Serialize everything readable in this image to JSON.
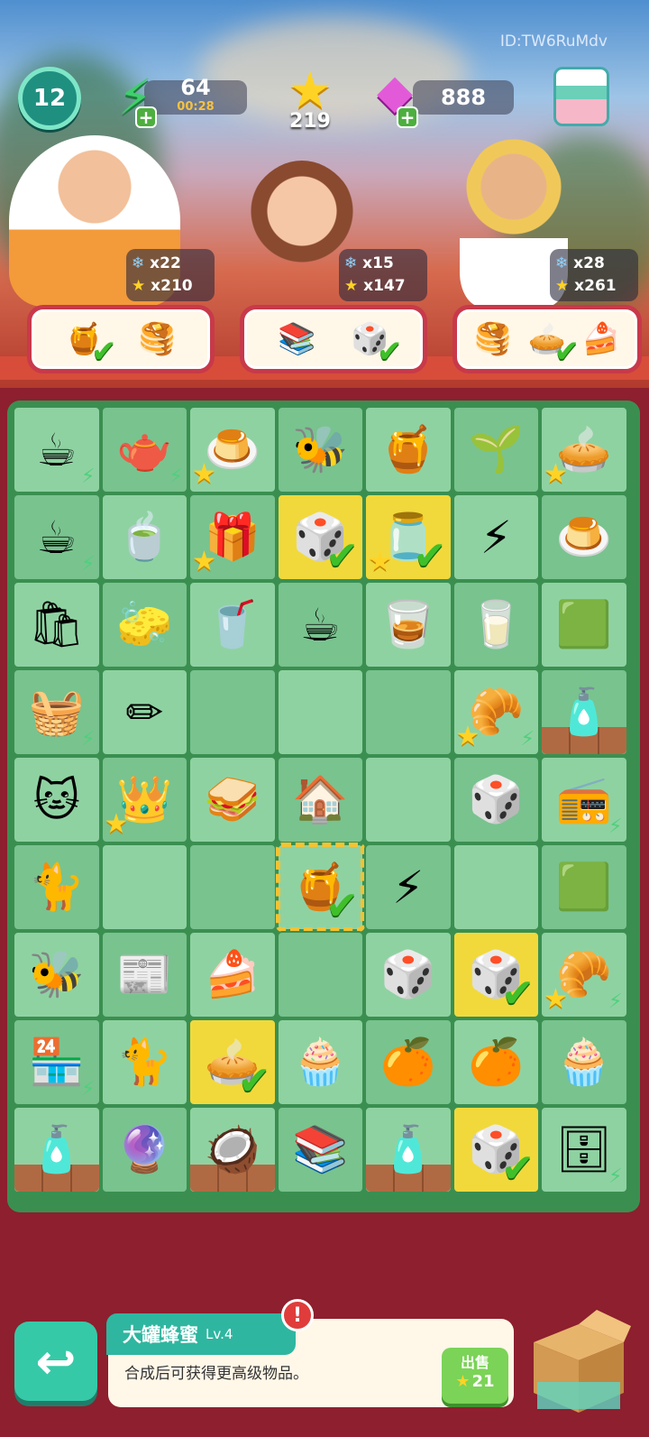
{
  "header": {
    "player_id": "ID:TW6RuMdv",
    "level": "12",
    "energy": {
      "value": "64",
      "timer": "00:28",
      "icon": "energy-bolt-icon"
    },
    "stars": {
      "value": "219",
      "icon": "star-icon"
    },
    "gems": {
      "value": "888",
      "icon": "gem-icon"
    },
    "shop_icon": "shop-stall-icon"
  },
  "customers": [
    {
      "snowflakes": "x22",
      "stars": "x210",
      "orders": [
        {
          "icon": "honey-jar",
          "glyph": "🍯",
          "done": true
        },
        {
          "icon": "pancakes",
          "glyph": "🥞",
          "done": false
        }
      ]
    },
    {
      "snowflakes": "x15",
      "stars": "x147",
      "orders": [
        {
          "icon": "books",
          "glyph": "📚",
          "done": false
        },
        {
          "icon": "dice-pawn",
          "glyph": "🎲",
          "done": true
        }
      ]
    },
    {
      "snowflakes": "x28",
      "stars": "x261",
      "orders": [
        {
          "icon": "pancakes",
          "glyph": "🥞",
          "done": false
        },
        {
          "icon": "orange-tart",
          "glyph": "🥧",
          "done": true
        },
        {
          "icon": "cake-slice",
          "glyph": "🍰",
          "done": false
        }
      ]
    }
  ],
  "board": [
    [
      {
        "i": "☕",
        "n": "teapot-tray",
        "bolt": true
      },
      {
        "i": "🫖",
        "n": "tea-set-tray",
        "bolt": true
      },
      {
        "i": "🍮",
        "n": "honey-pudding",
        "star": true
      },
      {
        "i": "🐝",
        "n": "beehive-small"
      },
      {
        "i": "🍯",
        "n": "beehive"
      },
      {
        "i": "🌱",
        "n": "sprout"
      },
      {
        "i": "🥧",
        "n": "fruit-tart",
        "star": true
      }
    ],
    [
      {
        "i": "☕",
        "n": "teapot-tray",
        "bolt": true
      },
      {
        "i": "🍵",
        "n": "tea-cup"
      },
      {
        "i": "🎁",
        "n": "mystery-chest",
        "star": true
      },
      {
        "i": "🎲",
        "n": "dice-pawn",
        "y": true,
        "chk": true
      },
      {
        "i": "🫙",
        "n": "glass-jar",
        "y": true,
        "chk": true,
        "star": true
      },
      {
        "i": "⚡",
        "n": "energy-bolt"
      },
      {
        "i": "🍮",
        "n": "flan"
      }
    ],
    [
      {
        "i": "🛍",
        "n": "shopping-bag"
      },
      {
        "i": "🧽",
        "n": "eraser"
      },
      {
        "i": "🥤",
        "n": "coffee-cup"
      },
      {
        "i": "☕",
        "n": "coffee-mug"
      },
      {
        "i": "🥃",
        "n": "cup-brown"
      },
      {
        "i": "🥛",
        "n": "water-glass"
      },
      {
        "i": "🟩",
        "n": "green-box"
      }
    ],
    [
      {
        "i": "🧺",
        "n": "picnic-basket",
        "bolt": true
      },
      {
        "i": "✏",
        "n": "pencil-sharpener"
      },
      {
        "i": "",
        "n": "empty"
      },
      {
        "i": "",
        "n": "empty"
      },
      {
        "i": "",
        "n": "empty"
      },
      {
        "i": "🥐",
        "n": "bread-crate",
        "star": true,
        "bolt": true
      },
      {
        "i": "🧴",
        "n": "bottle-web",
        "web": true
      }
    ],
    [
      {
        "i": "🐱",
        "n": "siamese-cat"
      },
      {
        "i": "👑",
        "n": "royal-chest",
        "star": true
      },
      {
        "i": "🥪",
        "n": "sandwich"
      },
      {
        "i": "🏠",
        "n": "timer-hut"
      },
      {
        "i": "",
        "n": "empty"
      },
      {
        "i": "🎲",
        "n": "die"
      },
      {
        "i": "📻",
        "n": "green-stove",
        "bolt": true
      }
    ],
    [
      {
        "i": "🐈",
        "n": "calico-kitten"
      },
      {
        "i": "",
        "n": "empty"
      },
      {
        "i": "",
        "n": "empty"
      },
      {
        "i": "🍯",
        "n": "honey-jar-large",
        "sel": true,
        "chk": true
      },
      {
        "i": "⚡",
        "n": "energy-bolt"
      },
      {
        "i": "",
        "n": "empty"
      },
      {
        "i": "🟩",
        "n": "green-cooker"
      }
    ],
    [
      {
        "i": "🐝",
        "n": "bee-honeycomb"
      },
      {
        "i": "📰",
        "n": "newspaper"
      },
      {
        "i": "🍰",
        "n": "cake-slice"
      },
      {
        "i": "",
        "n": "empty"
      },
      {
        "i": "🎲",
        "n": "die"
      },
      {
        "i": "🎲",
        "n": "dice-pawn",
        "y": true,
        "chk": true
      },
      {
        "i": "🥐",
        "n": "bread-crate",
        "star": true,
        "bolt": true
      }
    ],
    [
      {
        "i": "🏪",
        "n": "cat-stall",
        "bolt": true
      },
      {
        "i": "🐈",
        "n": "tabby-cat"
      },
      {
        "i": "🥧",
        "n": "orange-tart",
        "y": true,
        "chk": true
      },
      {
        "i": "🧁",
        "n": "green-cupcake"
      },
      {
        "i": "🍊",
        "n": "orange"
      },
      {
        "i": "🍊",
        "n": "orange"
      },
      {
        "i": "🧁",
        "n": "green-cupcake"
      }
    ],
    [
      {
        "i": "🧴",
        "n": "bottle-web",
        "web": true
      },
      {
        "i": "🔮",
        "n": "snow-globe"
      },
      {
        "i": "🥥",
        "n": "coconut-web",
        "web": true
      },
      {
        "i": "📚",
        "n": "books"
      },
      {
        "i": "🧴",
        "n": "bottle-web",
        "web": true
      },
      {
        "i": "🎲",
        "n": "dice-pawn",
        "y": true,
        "chk": true
      },
      {
        "i": "🗄",
        "n": "book-cart",
        "bolt": true
      }
    ]
  ],
  "selected_item": {
    "name": "大罐蜂蜜",
    "level": "Lv.4",
    "description": "合成后可获得更高级物品。",
    "sell_label": "出售",
    "sell_value": "21"
  },
  "colors": {
    "board": "#3a8f50",
    "cell_light": "#8fd2a2",
    "cell_dark": "#79c38f",
    "highlight": "#f1d93b",
    "banner": "#8d1f2e"
  }
}
